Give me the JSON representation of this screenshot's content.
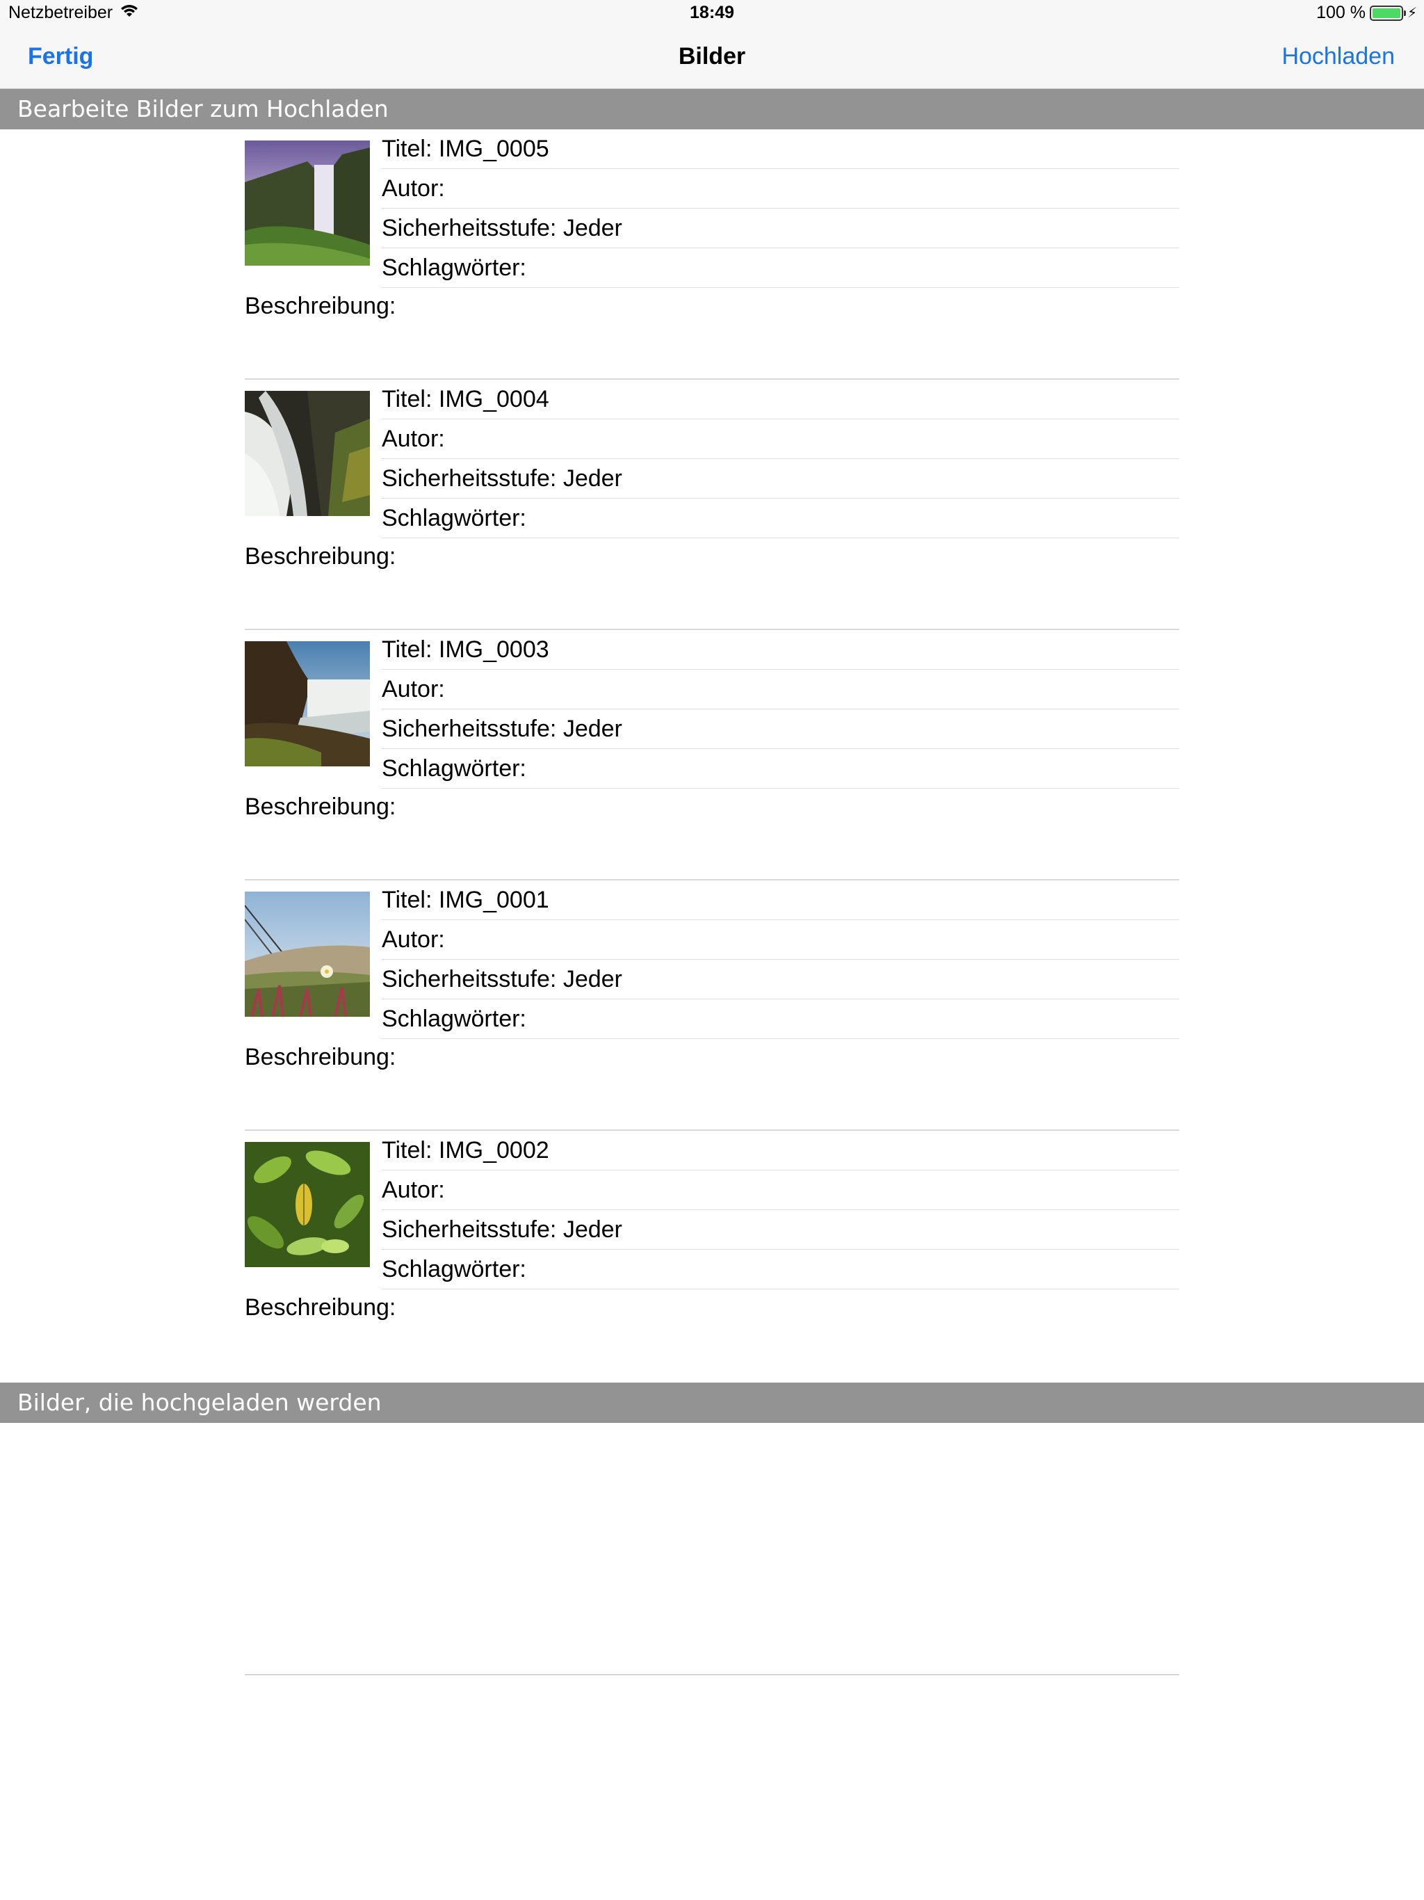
{
  "status_bar": {
    "carrier": "Netzbetreiber",
    "time": "18:49",
    "battery": "100 %",
    "battery_level": 1.0
  },
  "nav": {
    "left_button": "Fertig",
    "title": "Bilder",
    "right_button": "Hochladen"
  },
  "sections": {
    "edit_header": "Bearbeite Bilder zum Hochladen",
    "upload_header": "Bilder, die hochgeladen werden"
  },
  "labels": {
    "title": "Titel:",
    "author": "Autor:",
    "security": "Sicherheitsstufe:",
    "keywords": "Schlagwörter:",
    "description": "Beschreibung:"
  },
  "images": [
    {
      "title": "IMG_0005",
      "author": "",
      "security": "Jeder",
      "keywords": "",
      "description": "",
      "thumbnail": "waterfall-purple-sky"
    },
    {
      "title": "IMG_0004",
      "author": "",
      "security": "Jeder",
      "keywords": "",
      "description": "",
      "thumbnail": "waterfall-closeup"
    },
    {
      "title": "IMG_0003",
      "author": "",
      "security": "Jeder",
      "keywords": "",
      "description": "",
      "thumbnail": "waterfall-cliff"
    },
    {
      "title": "IMG_0001",
      "author": "",
      "security": "Jeder",
      "keywords": "",
      "description": "",
      "thumbnail": "flower-field"
    },
    {
      "title": "IMG_0002",
      "author": "",
      "security": "Jeder",
      "keywords": "",
      "description": "",
      "thumbnail": "green-leaves"
    }
  ],
  "colors": {
    "accent": "#1a73e8",
    "section_bg": "#939393",
    "bar_bg": "#f7f7f7",
    "battery": "#4cd964"
  }
}
